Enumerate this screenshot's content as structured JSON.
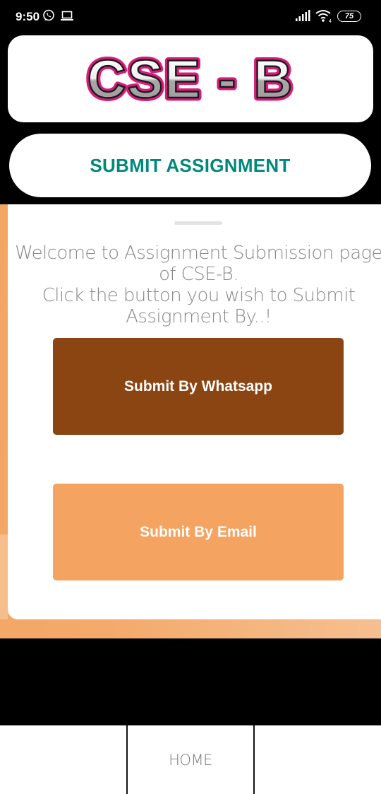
{
  "status_bar": {
    "time": "9:50",
    "battery": "75",
    "icons": [
      "whatsapp-icon",
      "laptop-icon",
      "signal-icon",
      "wifi-icon",
      "battery-icon"
    ]
  },
  "header": {
    "logo_text": "CSE - B",
    "submit_label": "SUBMIT ASSIGNMENT"
  },
  "sheet": {
    "welcome_text": "Welcome to Assignment Submission page of CSE-B.\nClick the button you wish to Submit Assignment By..!",
    "whatsapp_button": "Submit By Whatsapp",
    "email_button": "Submit By Email"
  },
  "bottom_nav": {
    "items": [
      {
        "label": ""
      },
      {
        "label": "HOME"
      },
      {
        "label": ""
      }
    ]
  },
  "colors": {
    "accent_teal": "#00897b",
    "whatsapp_button": "#8b4513",
    "email_button": "#f4a460",
    "background_orange": "#f4aa6b",
    "logo_outline": "#d81b7b"
  }
}
